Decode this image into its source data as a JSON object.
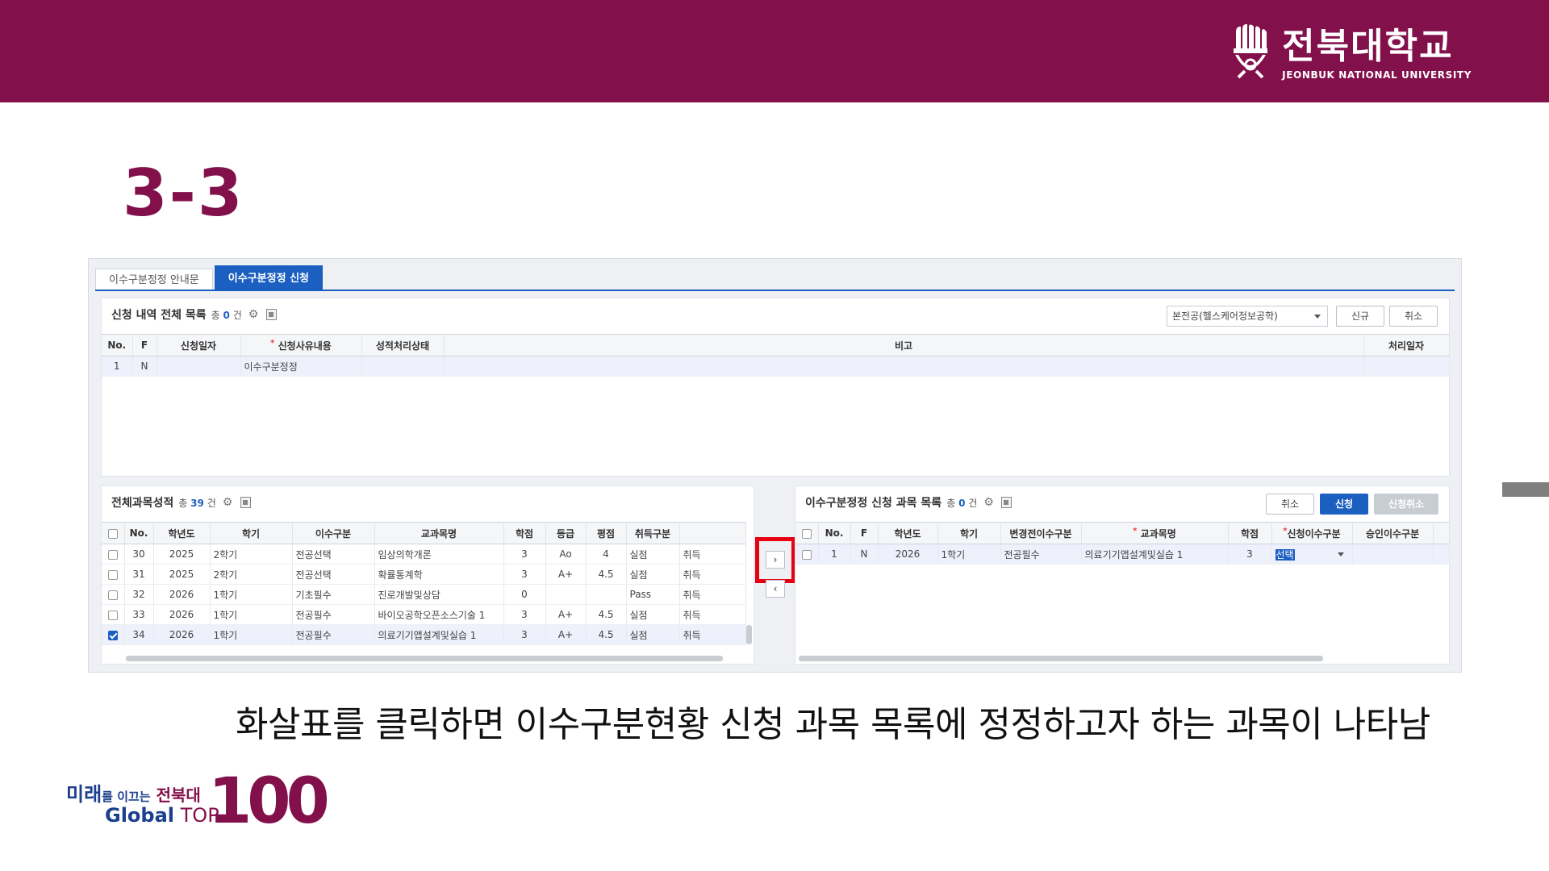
{
  "brand": {
    "name_ko": "전북대학교",
    "name_en": "JEONBUK NATIONAL UNIVERSITY",
    "colors": {
      "primary": "#82104b",
      "accent_blue": "#1b5fc1",
      "highlight_red": "#e60012"
    }
  },
  "slide": {
    "title": "3-3",
    "caption": "화살표를 클릭하면 이수구분현황 신청 과목 목록에 정정하고자 하는 과목이 나타남"
  },
  "bottom_logo": {
    "line1_a": "미래",
    "line1_b": "를 이끄는",
    "line1_c": "전북대",
    "line2_a": "Global",
    "line2_b": " TOP",
    "big": "100"
  },
  "tabs": [
    {
      "label": "이수구분정정 안내문",
      "active": false
    },
    {
      "label": "이수구분정정 신청",
      "active": true
    }
  ],
  "request_list": {
    "title": "신청 내역 전체 목록",
    "count_prefix": "총",
    "count": "0",
    "count_suffix": "건",
    "major_select": "본전공(헬스케어정보공학)",
    "new_button": "신규",
    "cancel_button": "취소",
    "columns": [
      "No.",
      "F",
      "신청일자",
      "신청사유내용",
      "성적처리상태",
      "비고",
      "처리일자"
    ],
    "rows": [
      {
        "no": "1",
        "f": "N",
        "date": "",
        "reason": "이수구분정정",
        "status": "",
        "note": "",
        "processed": ""
      }
    ]
  },
  "grades": {
    "title": "전체과목성적",
    "count_prefix": "총",
    "count": "39",
    "count_suffix": "건",
    "columns": [
      "No.",
      "학년도",
      "학기",
      "이수구분",
      "교과목명",
      "학점",
      "등급",
      "평점",
      "취득구분"
    ],
    "rows": [
      {
        "checked": false,
        "no": "30",
        "year": "2025",
        "term": "2학기",
        "type": "전공선택",
        "course": "임상의학개론",
        "credit": "3",
        "grade": "Ao",
        "point": "4",
        "acq": "실점",
        "extra": "취득"
      },
      {
        "checked": false,
        "no": "31",
        "year": "2025",
        "term": "2학기",
        "type": "전공선택",
        "course": "확률통계학",
        "credit": "3",
        "grade": "A+",
        "point": "4.5",
        "acq": "실점",
        "extra": "취득"
      },
      {
        "checked": false,
        "no": "32",
        "year": "2026",
        "term": "1학기",
        "type": "기초필수",
        "course": "진로개발및상담",
        "credit": "0",
        "grade": "",
        "point": "",
        "acq": "Pass",
        "extra": "취득"
      },
      {
        "checked": false,
        "no": "33",
        "year": "2026",
        "term": "1학기",
        "type": "전공필수",
        "course": "바이오공학오픈소스기술 1",
        "credit": "3",
        "grade": "A+",
        "point": "4.5",
        "acq": "실점",
        "extra": "취득"
      },
      {
        "checked": true,
        "no": "34",
        "year": "2026",
        "term": "1학기",
        "type": "전공필수",
        "course": "의료기기앱설계및실습 1",
        "credit": "3",
        "grade": "A+",
        "point": "4.5",
        "acq": "실점",
        "extra": "취득"
      }
    ]
  },
  "transfer": {
    "right_arrow": "›",
    "left_arrow": "‹"
  },
  "correction": {
    "title": "이수구분정정 신청 과목 목록",
    "count_prefix": "총",
    "count": "0",
    "count_suffix": "건",
    "cancel_button": "취소",
    "apply_button": "신청",
    "withdraw_button": "신청취소",
    "columns": [
      "No.",
      "F",
      "학년도",
      "학기",
      "변경전이수구분",
      "교과목명",
      "학점",
      "신청이수구분",
      "승인이수구분"
    ],
    "rows": [
      {
        "checked": false,
        "no": "1",
        "f": "N",
        "year": "2026",
        "term": "1학기",
        "before": "전공필수",
        "course": "의료기기앱설계및실습 1",
        "credit": "3",
        "requested": "선택",
        "approved": ""
      }
    ]
  }
}
